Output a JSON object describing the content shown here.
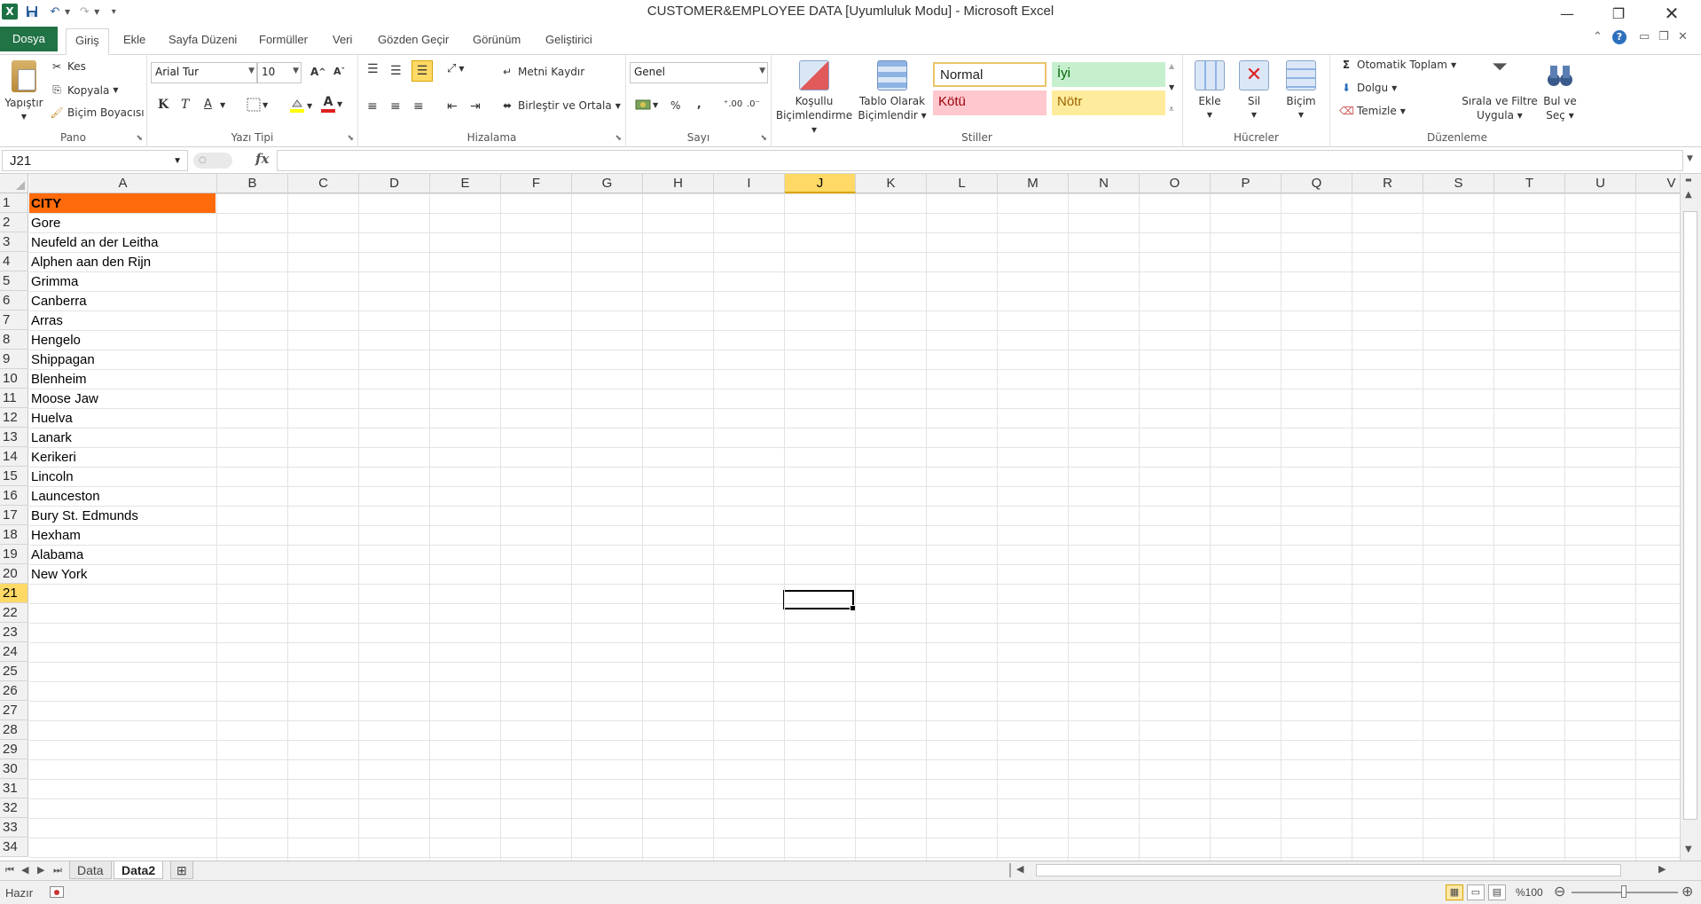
{
  "window": {
    "title": "CUSTOMER&EMPLOYEE DATA  [Uyumluluk Modu]  -  Microsoft Excel"
  },
  "tabs": [
    "Dosya",
    "Giriş",
    "Ekle",
    "Sayfa Düzeni",
    "Formüller",
    "Veri",
    "Gözden Geçir",
    "Görünüm",
    "Geliştirici"
  ],
  "ribbon": {
    "clipboard": {
      "paste": "Yapıştır",
      "cut": "Kes",
      "copy": "Kopyala",
      "format_painter": "Biçim Boyacısı",
      "group": "Pano"
    },
    "font": {
      "name": "Arial Tur",
      "size": "10",
      "bold": "K",
      "italic": "T",
      "underline": "A",
      "group": "Yazı Tipi"
    },
    "alignment": {
      "wrap": "Metni Kaydır",
      "merge": "Birleştir ve Ortala",
      "group": "Hizalama"
    },
    "number": {
      "format": "Genel",
      "percent": "%",
      "comma": ",",
      "group": "Sayı"
    },
    "styles": {
      "conditional": [
        "Koşullu",
        "Biçimlendirme"
      ],
      "table": [
        "Tablo Olarak",
        "Biçimlendir"
      ],
      "normal": "Normal",
      "good": "İyi",
      "bad": "Kötü",
      "neutral": "Nötr",
      "group": "Stiller"
    },
    "cells": {
      "insert": "Ekle",
      "delete": "Sil",
      "format": "Biçim",
      "group": "Hücreler"
    },
    "editing": {
      "autosum": "Otomatik Toplam",
      "fill": "Dolgu",
      "clear": "Temizle",
      "sort": [
        "Sırala ve Filtre",
        "Uygula"
      ],
      "find": [
        "Bul ve",
        "Seç"
      ],
      "group": "Düzenleme"
    }
  },
  "formula_bar": {
    "name_box": "J21",
    "fx": "fx",
    "value": ""
  },
  "columns": [
    "A",
    "B",
    "C",
    "D",
    "E",
    "F",
    "G",
    "H",
    "I",
    "J",
    "K",
    "L",
    "M",
    "N",
    "O",
    "P",
    "Q",
    "R",
    "S",
    "T",
    "U",
    "V"
  ],
  "rows": [
    "1",
    "2",
    "3",
    "4",
    "5",
    "6",
    "7",
    "8",
    "9",
    "10",
    "11",
    "12",
    "13",
    "14",
    "15",
    "16",
    "17",
    "18",
    "19",
    "20",
    "21",
    "22",
    "23",
    "24",
    "25",
    "26",
    "27",
    "28",
    "29",
    "30",
    "31",
    "32",
    "33",
    "34"
  ],
  "cells": [
    "CITY",
    "Gore",
    "Neufeld an der Leitha",
    "Alphen aan den Rijn",
    "Grimma",
    "Canberra",
    "Arras",
    "Hengelo",
    "Shippagan",
    "Blenheim",
    "Moose Jaw",
    "Huelva",
    "Lanark",
    "Kerikeri",
    "Lincoln",
    "Launceston",
    "Bury St. Edmunds",
    "Hexham",
    "Alabama",
    "New York"
  ],
  "sheets": [
    "Data",
    "Data2"
  ],
  "status": {
    "ready": "Hazır",
    "zoom": "%100"
  },
  "colors": {
    "header_fill": "#ff6a0a",
    "accent": "#217346",
    "selection": "#ffd966"
  }
}
